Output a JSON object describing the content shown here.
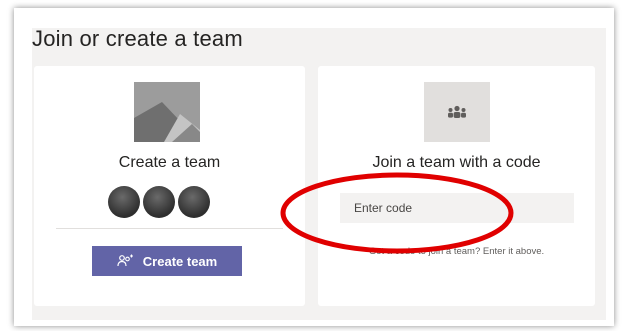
{
  "page": {
    "title": "Join or create a team"
  },
  "create_card": {
    "title": "Create a team",
    "button_label": "Create team",
    "image_icon": "image-placeholder-icon",
    "button_icon": "people-add-icon",
    "avatar_count": 3
  },
  "join_card": {
    "title": "Join a team with a code",
    "input_placeholder": "Enter code",
    "input_value": "",
    "hint": "Got a code to join a team? Enter it above.",
    "tile_icon": "team-icon"
  },
  "annotation": {
    "shape": "ellipse",
    "color": "#e00000"
  },
  "colors": {
    "accent": "#6264a7",
    "panel_bg": "#f3f2f1",
    "card_bg": "#ffffff",
    "annotation": "#e00000"
  }
}
